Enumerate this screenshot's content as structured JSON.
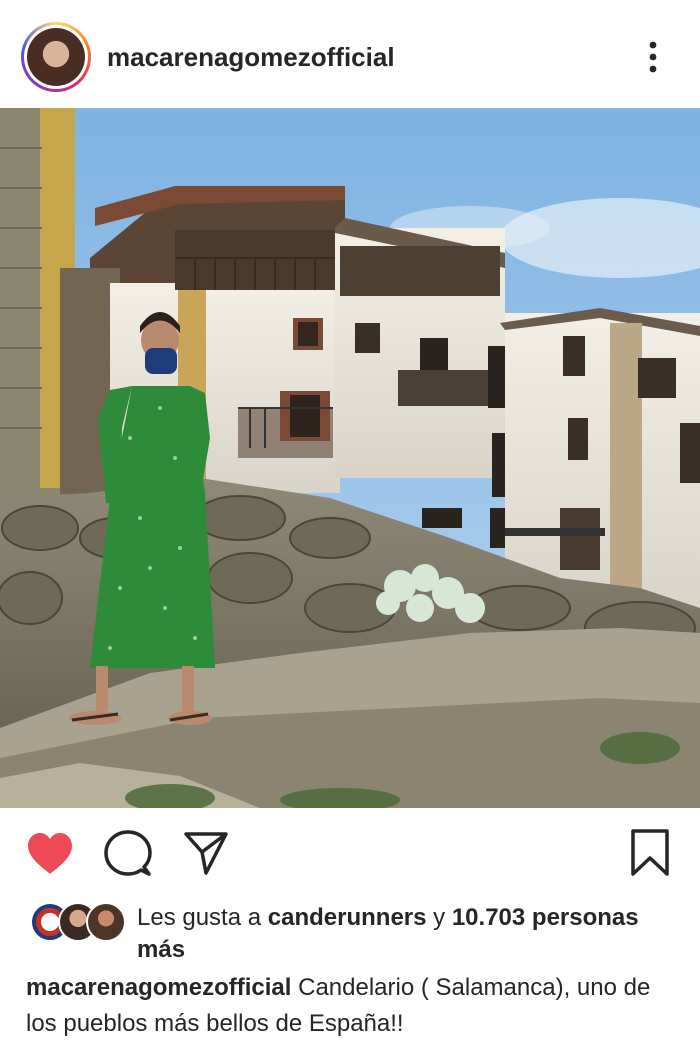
{
  "post": {
    "username": "macarenagomezofficial",
    "likes": {
      "prefix": "Les gusta a",
      "user": "canderunners",
      "joiner": "y",
      "count": "10.703",
      "suffix": "personas más"
    },
    "caption": {
      "username": "macarenagomezofficial",
      "text": "Candelario ( Salamanca), uno de los pueblos más bellos de España!!"
    }
  },
  "icons": {
    "more": "more-vertical-icon",
    "like": "heart-icon",
    "comment": "comment-icon",
    "share": "send-icon",
    "save": "bookmark-icon"
  },
  "colors": {
    "like_active": "#ed4956",
    "text": "#262626",
    "dress": "#2e8b3a"
  }
}
